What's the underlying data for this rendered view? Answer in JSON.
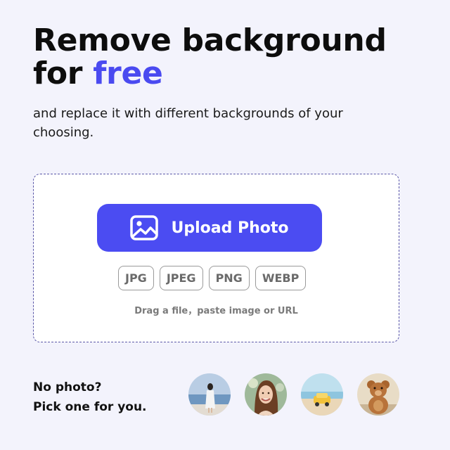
{
  "hero": {
    "title_line1": "Remove background",
    "title_line2_prefix": "for ",
    "title_line2_accent": "free",
    "subtitle": "and replace it with different backgrounds of your choosing."
  },
  "upload": {
    "button_label": "Upload Photo",
    "button_icon": "image-icon",
    "formats": [
      "JPG",
      "JPEG",
      "PNG",
      "WEBP"
    ],
    "drag_hint": "Drag a file，paste image or URL"
  },
  "samples": {
    "prompt_line1": "No photo?",
    "prompt_line2": "Pick one for you.",
    "items": [
      {
        "name": "woman-on-beach"
      },
      {
        "name": "smiling-woman-portrait"
      },
      {
        "name": "toy-car-on-beach"
      },
      {
        "name": "teddy-bear"
      }
    ]
  },
  "colors": {
    "accent": "#4a4af0",
    "button": "#4b4cf2",
    "background": "#f3f3fc"
  }
}
